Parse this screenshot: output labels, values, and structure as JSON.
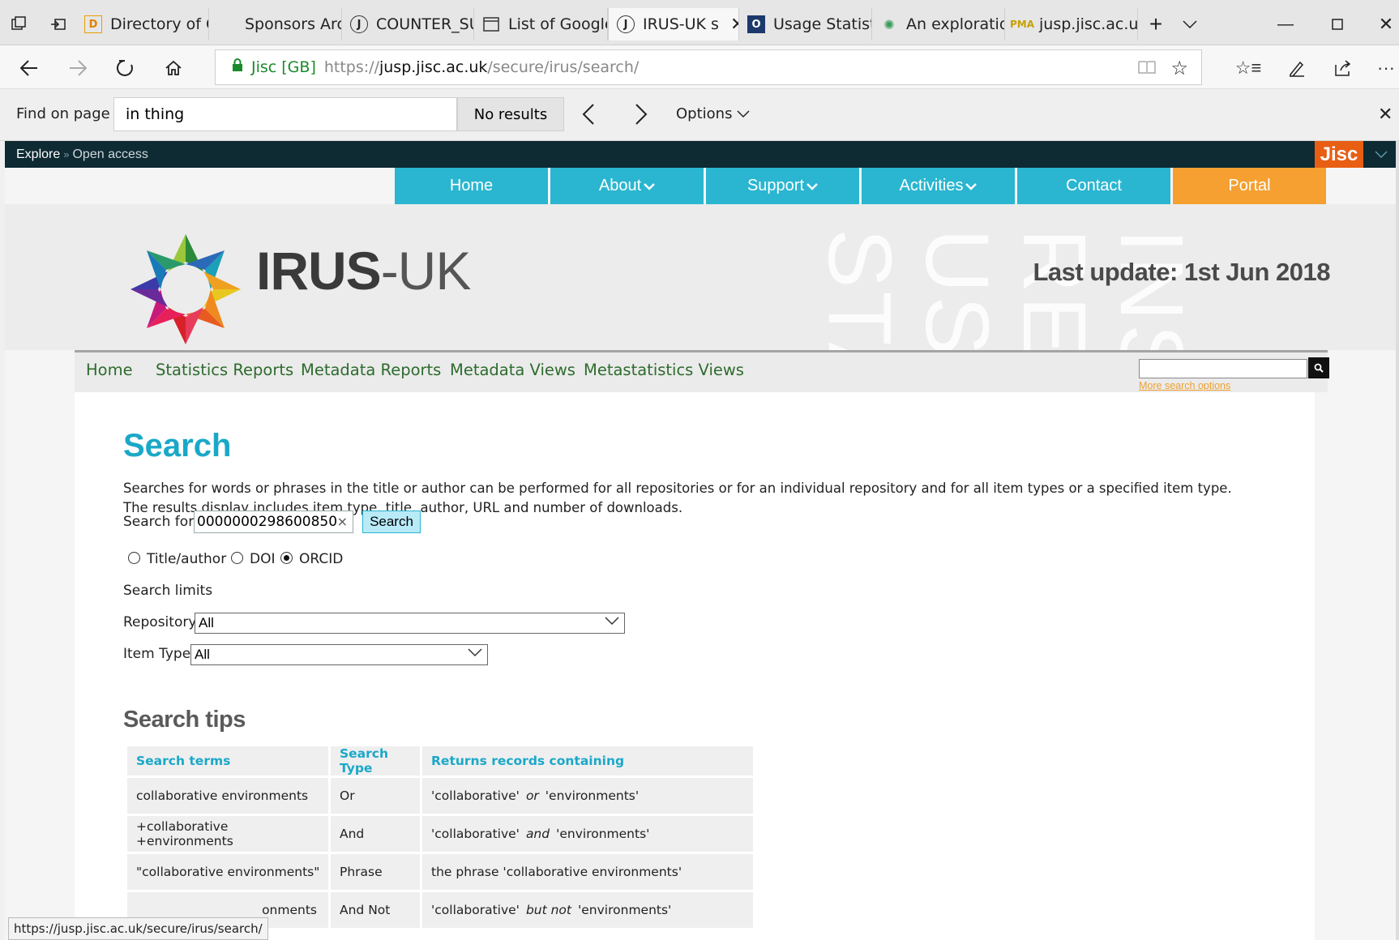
{
  "browser": {
    "tabs": [
      {
        "label": "Directory of C",
        "icon": "letter-d-icon"
      },
      {
        "label": "Sponsors Arch",
        "icon": "blank-page-icon"
      },
      {
        "label": "COUNTER_SU",
        "icon": "j-icon"
      },
      {
        "label": "List of Google",
        "icon": "page-icon"
      },
      {
        "label": "IRUS-UK s",
        "icon": "j-icon",
        "active": true
      },
      {
        "label": "Usage Statisti",
        "icon": "o-icon"
      },
      {
        "label": "An exploratio",
        "icon": "plos-icon"
      },
      {
        "label": "jusp.jisc.ac.uk",
        "icon": "pma-icon"
      }
    ],
    "url": {
      "cert": "Jisc [GB]",
      "prefix": "https://",
      "host": "jusp.jisc.ac.uk",
      "path": "/secure/irus/search/"
    },
    "find": {
      "label": "Find on page",
      "value": "in thing",
      "results": "No results",
      "options": "Options"
    },
    "status_url": "https://jusp.jisc.ac.uk/secure/irus/search/"
  },
  "site": {
    "breadcrumb": {
      "first": "Explore",
      "sep": "»",
      "second": "Open access"
    },
    "brand": "Jisc",
    "topnav": [
      "Home",
      "About",
      "Support",
      "Activities",
      "Contact",
      "Portal"
    ],
    "logo_main": "IRUS",
    "logo_sub": "-UK",
    "last_update": "Last update: 1st Jun 2018",
    "subnav": [
      "Home",
      "Statistics Reports",
      "Metadata Reports",
      "Metadata Views",
      "Metastatistics Views"
    ],
    "more_search": "More search options"
  },
  "search": {
    "title": "Search",
    "description": "Searches for words or phrases in the title or author can be performed for all repositories or for an individual repository and for all item types or a specified item type. The results display includes item type, title, author, URL and number of downloads.",
    "search_for_label": "Search for:",
    "query": "0000000298600850",
    "button": "Search",
    "radio_options": [
      "Title/author",
      "DOI",
      "ORCID"
    ],
    "radio_selected": "ORCID",
    "limits_label": "Search limits",
    "repository_label": "Repository:",
    "repository_value": "All",
    "itemtype_label": "Item Type:",
    "itemtype_value": "All"
  },
  "tips": {
    "heading": "Search tips",
    "columns": [
      "Search terms",
      "Search Type",
      "Returns records containing"
    ],
    "rows": [
      {
        "term": "collaborative environments",
        "type": "Or",
        "a": "'collaborative'",
        "op": "or",
        "b": "'environments'"
      },
      {
        "term": "+collaborative +environments",
        "type": "And",
        "a": "'collaborative'",
        "op": "and",
        "b": "'environments'"
      },
      {
        "term": "\"collaborative environments\"",
        "type": "Phrase",
        "a": "the phrase 'collaborative environments'",
        "op": "",
        "b": ""
      },
      {
        "term": "onments",
        "type": "And Not",
        "a": "'collaborative'",
        "op": "but not",
        "b": "'environments'"
      }
    ]
  },
  "colors": {
    "accent": "#2ab6d0",
    "portal": "#f5a031",
    "jisc": "#e85e13",
    "dark_strip": "#0e2a33",
    "subnav_link": "#2d6b2d"
  }
}
